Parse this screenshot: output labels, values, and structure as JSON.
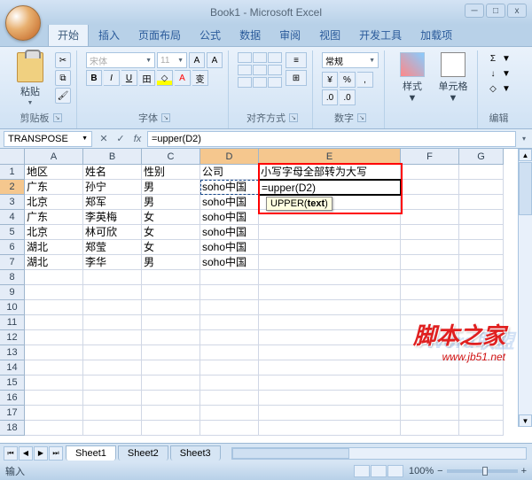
{
  "title": "Book1 - Microsoft Excel",
  "tabs": [
    "开始",
    "插入",
    "页面布局",
    "公式",
    "数据",
    "审阅",
    "视图",
    "开发工具",
    "加载项"
  ],
  "ribbon": {
    "clipboard": {
      "paste": "粘贴",
      "label": "剪贴板"
    },
    "font": {
      "name": "宋体",
      "size": "11",
      "label": "字体"
    },
    "align": {
      "wrap": "常规",
      "label": "对齐方式"
    },
    "number": {
      "label": "数字"
    },
    "style": {
      "btn": "样式",
      "cell": "单元格"
    },
    "edit": {
      "label": "编辑",
      "sum": "Σ",
      "fill": "↓",
      "clear": "◇"
    }
  },
  "namebox": "TRANSPOSE",
  "formula": "=upper(D2)",
  "tooltip": "UPPER(text)",
  "columns": [
    "A",
    "B",
    "C",
    "D",
    "E",
    "F",
    "G"
  ],
  "chart_data": {
    "type": "table",
    "columns": [
      "地区",
      "姓名",
      "性别",
      "公司",
      "小写字母全部转为大写"
    ],
    "rows": [
      [
        "广东",
        "孙宁",
        "男",
        "soho中国",
        "=upper(D2)"
      ],
      [
        "北京",
        "郑军",
        "男",
        "soho中国",
        ""
      ],
      [
        "广东",
        "李英梅",
        "女",
        "soho中国",
        ""
      ],
      [
        "北京",
        "林可欣",
        "女",
        "soho中国",
        ""
      ],
      [
        "湖北",
        "郑莹",
        "女",
        "soho中国",
        ""
      ],
      [
        "湖北",
        "李华",
        "男",
        "soho中国",
        ""
      ]
    ]
  },
  "sheets": [
    "Sheet1",
    "Sheet2",
    "Sheet3"
  ],
  "status": "输入",
  "zoom": "100%",
  "watermark": {
    "main": "脚本之家",
    "sub": "www.jb51.net",
    "blue": "Word联盟"
  }
}
